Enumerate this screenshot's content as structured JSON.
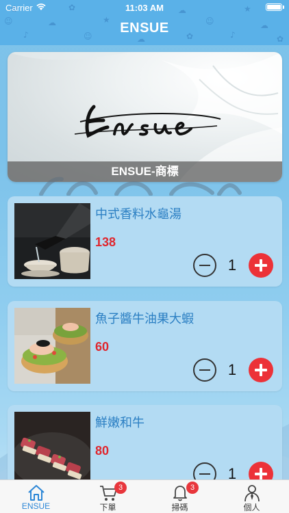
{
  "status_bar": {
    "carrier": "Carrier",
    "time": "11:03 AM",
    "wifi_icon": "wifi-icon",
    "battery_level": 1.0
  },
  "header": {
    "title": "ENSUE"
  },
  "banner": {
    "caption": "ENSUE-商標",
    "logo_text": "Ensue"
  },
  "products": [
    {
      "name": "中式香料水龜湯",
      "price": "138",
      "quantity": "1"
    },
    {
      "name": "魚子醬牛油果大蝦",
      "price": "60",
      "quantity": "1"
    },
    {
      "name": "鮮嫩和牛",
      "price": "80",
      "quantity": "1"
    }
  ],
  "tabbar": {
    "items": [
      {
        "label": "ENSUE",
        "icon": "home-icon",
        "active": true
      },
      {
        "label": "下單",
        "icon": "cart-icon",
        "badge": "3"
      },
      {
        "label": "掃碼",
        "icon": "bell-icon",
        "badge": "3"
      },
      {
        "label": "個人",
        "icon": "person-icon"
      }
    ]
  },
  "colors": {
    "accent": "#2b86d6",
    "price": "#e0262d",
    "add_button": "#ec3238",
    "card": "#b3dbf3",
    "header": "#5ab1e8"
  }
}
